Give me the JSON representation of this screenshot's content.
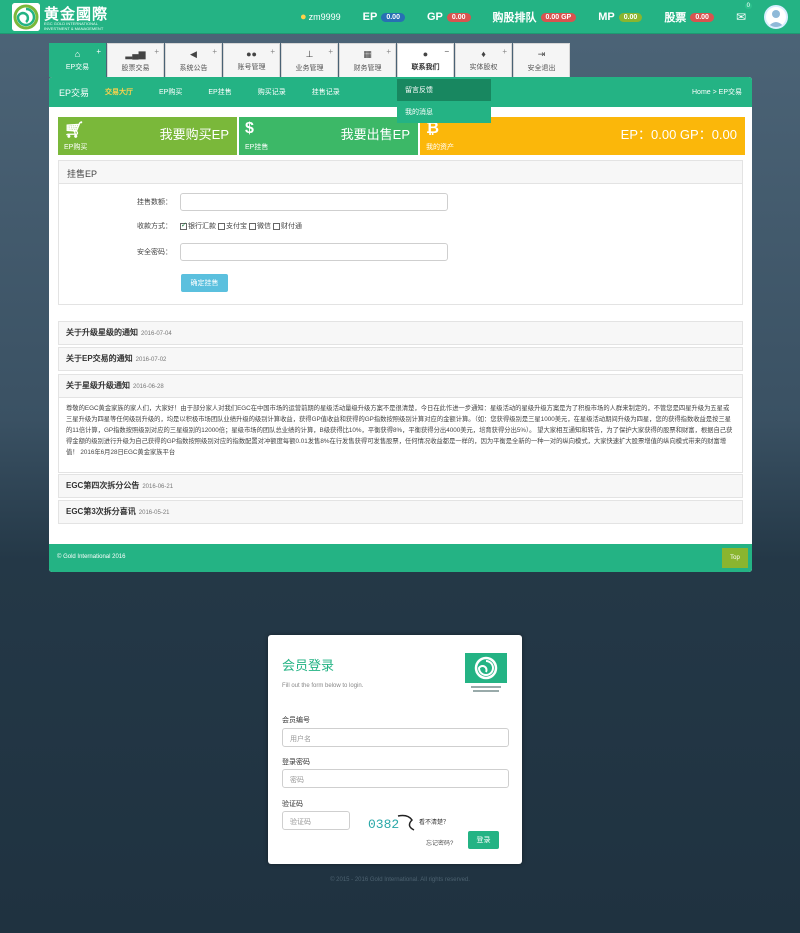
{
  "header": {
    "logo_title": "黄金國際",
    "logo_sub": "EGC GOLD INTERNATIONAL INVESTMENT & MANAGEMENT",
    "user": "zm9999",
    "stats": [
      {
        "label": "EP",
        "value": "0.00",
        "color": "#2770b3"
      },
      {
        "label": "GP",
        "value": "0.00",
        "color": "#d9534f"
      },
      {
        "label": "购股排队",
        "value": "0.00 GP",
        "color": "#d9534f"
      },
      {
        "label": "MP",
        "value": "0.00",
        "color": "#8ab52f"
      },
      {
        "label": "股票",
        "value": "0.00",
        "color": "#d9534f"
      }
    ],
    "mail_count": "0"
  },
  "tabs": [
    {
      "label": "EP交易",
      "icon": "home-icon"
    },
    {
      "label": "股票交易",
      "icon": "bar-chart-icon"
    },
    {
      "label": "系统公告",
      "icon": "megaphone-icon"
    },
    {
      "label": "账号管理",
      "icon": "users-icon"
    },
    {
      "label": "业务管理",
      "icon": "sitemap-icon"
    },
    {
      "label": "财务管理",
      "icon": "table-icon"
    },
    {
      "label": "联系我们",
      "icon": "comments-icon"
    },
    {
      "label": "实体股权",
      "icon": "fire-icon"
    },
    {
      "label": "安全退出",
      "icon": "sign-out-icon"
    }
  ],
  "dropdown": [
    "留言反馈",
    "我的消息"
  ],
  "subnav": {
    "brand": "EP交易",
    "links": [
      "交易大厅",
      "EP购买",
      "EP挂售",
      "购买记录",
      "挂售记录"
    ],
    "breadcrumb": "Home > EP交易"
  },
  "cards": [
    {
      "title": "我要购买EP",
      "sub": "EP购买"
    },
    {
      "title": "我要出售EP",
      "sub": "EP挂售"
    },
    {
      "title": "EP：0.00 GP：0.00",
      "sub": "我的资产"
    }
  ],
  "form": {
    "heading": "挂售EP",
    "amount_label": "挂售数额：",
    "pay_label": "收款方式：",
    "pay_options": [
      "银行汇款",
      "支付宝",
      "微信",
      "财付通"
    ],
    "pay_checked": [
      true,
      false,
      false,
      false
    ],
    "password_label": "安全密码：",
    "submit": "确定挂售"
  },
  "notices": [
    {
      "title": "关于升级星级的通知",
      "date": "2016-07-04"
    },
    {
      "title": "关于EP交易的通知",
      "date": "2016-07-02"
    },
    {
      "title": "关于星级升级通知",
      "date": "2016-06-28",
      "body": "尊敬的EGC黄金家族的家人们，大家好！由于部分家人对我们EGC在中国市场的运营前期的星级活动量级升级方案不是很清楚，今日在此作进一步通知：星级活动的星级升级方案是为了积极市场的人群来制定的，不管您是四星升级为五星或三星升级为四星等任何级别升级的，均是以积极市场团队业绩升级的级别计算收益，获得GP值收益和获得的GP指数按照级别计算对应的金额计算。（如：您获得级别是三星1000美元，在星级活动期间升级为四星，您的获得指数收益是按三星的11倍计算，GP指数按照级别对应的三星级别的12000倍；星级市场的团队总业绩的计算，B级获得比10%，平衡获得8%，平衡获得分出4000美元，培育获得分出5%）。 望大家相互通知和转告，为了保护大家获得的股票和财富，根据自己获得金额的级别进行升级为自己获得的GP指数按照级别对应的指数配置对冲额度每额0.01发售8%在行发售获得可发售股票，任何情况收益都是一样的，因为平衡是全新的一种一对的纵向模式，大家快速扩大股票增值的纵向模式带来的财富增值！ 2016年6月28日EGC黄金家族平台"
    },
    {
      "title": "EGC第四次拆分公告",
      "date": "2016-06-21"
    },
    {
      "title": "EGC第3次拆分喜讯",
      "date": "2016-05-21"
    }
  ],
  "footer": {
    "text": "© Gold International 2016",
    "top": "Top"
  },
  "login": {
    "title": "会员登录",
    "subtitle": "Fill out the form below to login.",
    "user_label": "会员编号",
    "user_placeholder": "用户名",
    "pwd_label": "登录密码",
    "pwd_placeholder": "密码",
    "code_label": "验证码",
    "code_placeholder": "验证码",
    "captcha": "0382",
    "captcha_tip": "看不清楚？",
    "forgot": "忘记密码?",
    "submit": "登录"
  },
  "copyright": "© 2015 - 2016 Gold International. All rights reserved."
}
